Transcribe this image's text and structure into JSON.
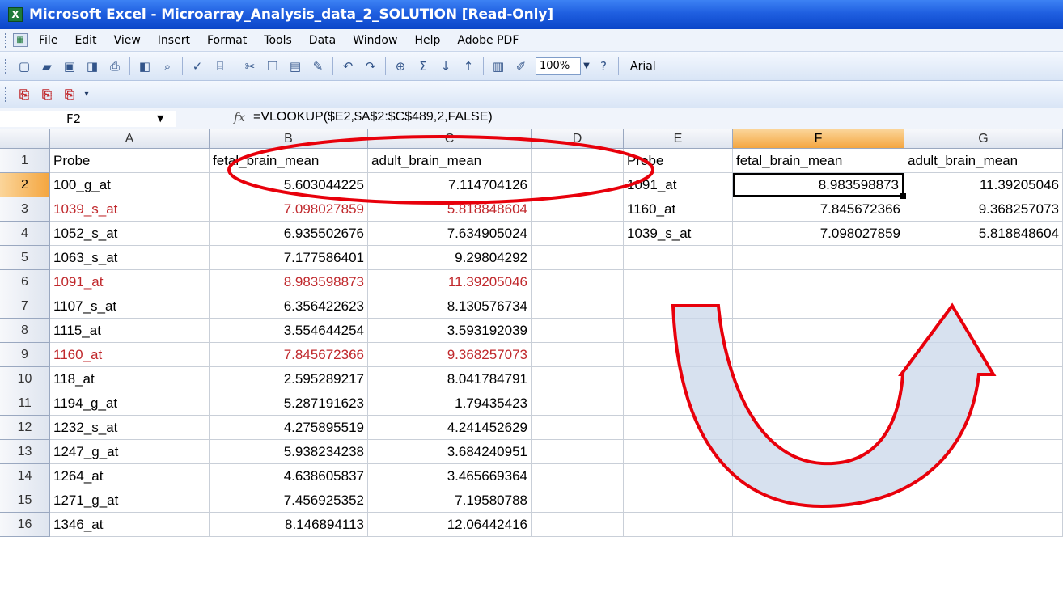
{
  "window": {
    "title": "Microsoft Excel - Microarray_Analysis_data_2_SOLUTION  [Read-Only]"
  },
  "menu": [
    "File",
    "Edit",
    "View",
    "Insert",
    "Format",
    "Tools",
    "Data",
    "Window",
    "Help",
    "Adobe PDF"
  ],
  "toolbar": {
    "zoom": "100%",
    "font": "Arial",
    "sigma": "Σ"
  },
  "formula_bar": {
    "name_box": "F2",
    "fx": "fx",
    "formula": "=VLOOKUP($E2,$A$2:$C$489,2,FALSE)"
  },
  "columns": [
    "A",
    "B",
    "C",
    "D",
    "E",
    "F",
    "G"
  ],
  "rows": [
    [
      "1",
      "Probe",
      "fetal_brain_mean",
      "adult_brain_mean",
      "",
      "Probe",
      "fetal_brain_mean",
      "adult_brain_mean"
    ],
    [
      "2",
      "100_g_at",
      "5.603044225",
      "7.114704126",
      "",
      "1091_at",
      "8.983598873",
      "11.39205046"
    ],
    [
      "3",
      "1039_s_at",
      "7.098027859",
      "5.818848604",
      "",
      "1160_at",
      "7.845672366",
      "9.368257073"
    ],
    [
      "4",
      "1052_s_at",
      "6.935502676",
      "7.634905024",
      "",
      "1039_s_at",
      "7.098027859",
      "5.818848604"
    ],
    [
      "5",
      "1063_s_at",
      "7.177586401",
      "9.29804292",
      "",
      "",
      "",
      ""
    ],
    [
      "6",
      "1091_at",
      "8.983598873",
      "11.39205046",
      "",
      "",
      "",
      ""
    ],
    [
      "7",
      "1107_s_at",
      "6.356422623",
      "8.130576734",
      "",
      "",
      "",
      ""
    ],
    [
      "8",
      "1115_at",
      "3.554644254",
      "3.593192039",
      "",
      "",
      "",
      ""
    ],
    [
      "9",
      "1160_at",
      "7.845672366",
      "9.368257073",
      "",
      "",
      "",
      ""
    ],
    [
      "10",
      "118_at",
      "2.595289217",
      "8.041784791",
      "",
      "",
      "",
      ""
    ],
    [
      "11",
      "1194_g_at",
      "5.287191623",
      "1.79435423",
      "",
      "",
      "",
      ""
    ],
    [
      "12",
      "1232_s_at",
      "4.275895519",
      "4.241452629",
      "",
      "",
      "",
      ""
    ],
    [
      "13",
      "1247_g_at",
      "5.938234238",
      "3.684240951",
      "",
      "",
      "",
      ""
    ],
    [
      "14",
      "1264_at",
      "4.638605837",
      "3.465669364",
      "",
      "",
      "",
      ""
    ],
    [
      "15",
      "1271_g_at",
      "7.456925352",
      "7.19580788",
      "",
      "",
      "",
      ""
    ],
    [
      "16",
      "1346_at",
      "8.146894113",
      "12.06442416",
      "",
      "",
      "",
      ""
    ]
  ],
  "highlight_rows": [
    3,
    6,
    9
  ],
  "active_cell": "F2",
  "colors": {
    "highlight_text": "#c0282c",
    "annotation_red": "#e8000b",
    "arrow_fill": "#c9d7ea"
  }
}
